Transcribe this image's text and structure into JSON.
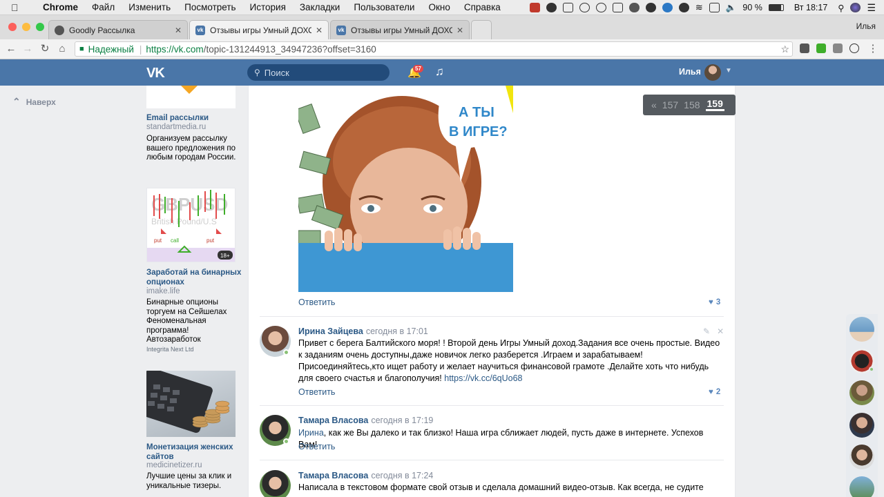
{
  "mac_menu": {
    "items": [
      "Chrome",
      "Файл",
      "Изменить",
      "Посмотреть",
      "История",
      "Закладки",
      "Пользователи",
      "Окно",
      "Справка"
    ],
    "battery": "90 %",
    "clock": "Вт 18:17"
  },
  "browser": {
    "tabs": [
      {
        "title": "Goodly Рассылка"
      },
      {
        "title": "Отзывы игры Умный ДОХОД"
      },
      {
        "title": "Отзывы игры Умный ДОХОД"
      }
    ],
    "profile": "Илья",
    "secure_label": "Надежный",
    "url_host": "https://vk.com",
    "url_path": "/topic-131244913_34947236?offset=3160"
  },
  "vk_header": {
    "logo": "VK",
    "search_placeholder": "Поиск",
    "notifications_count": "57",
    "user_name": "Илья"
  },
  "left_nav": {
    "back_to_top": "Наверх"
  },
  "ads": [
    {
      "title": "Email рассылки",
      "domain": "standartmedia.ru",
      "text": "Организуем рассылку вашего предложения по любым городам России."
    },
    {
      "title": "Заработай на бинарных опционах",
      "domain": "imake.life",
      "text": "Бинарные опционы торгуем на Сейшелах Феноменальная программа! Автозаработок",
      "footer": "Integrita Next Ltd",
      "age_badge": "18+",
      "img_label_big": "GBPUSD",
      "img_label_small": "British Pound/U.S",
      "put": "put",
      "call": "call"
    },
    {
      "title": "Монетизация женских сайтов",
      "domain": "medicinetizer.ru",
      "text": "Лучшие цены за клик и уникальные тизеры."
    }
  ],
  "post_image": {
    "bubble_line1": "А ТЫ",
    "bubble_line2": "В ИГРЕ?"
  },
  "pager": {
    "prev": "«",
    "pages": [
      "157",
      "158",
      "159"
    ],
    "current": "159"
  },
  "post": {
    "reply_label": "Ответить",
    "likes": "3"
  },
  "comments": [
    {
      "author": "Ирина Зайцева",
      "date": "сегодня в 17:01",
      "text": "Привет с берега Балтийского моря! ! Второй день Игры Умный доход.Задания все очень простые. Видео к заданиям очень доступны,даже новичок легко разберется .Играем и зарабатываем! Присоединяйтесь,кто ищет работу и желает научиться финансовой грамоте .Делайте хоть что нибудь для своего счастья и благополучия!",
      "link": "https://vk.cc/6qUo68",
      "reply_label": "Ответить",
      "likes": "2"
    },
    {
      "author": "Тамара Власова",
      "date": "сегодня в 17:19",
      "mention": "Ирина",
      "text": ", как же Вы далеко и так близко! Наша игра сближает людей, пусть даже в интернете. Успехов Вам!",
      "reply_label": "Ответить"
    },
    {
      "author": "Тамара Власова",
      "date": "сегодня в 17:24",
      "text": "Написала в текстовом формате свой отзыв и сделала домашний видео-отзыв. Как всегда, не судите"
    }
  ],
  "colors": {
    "vk_blue": "#4a76a8",
    "link": "#2a5885",
    "online": "#8ac176"
  }
}
